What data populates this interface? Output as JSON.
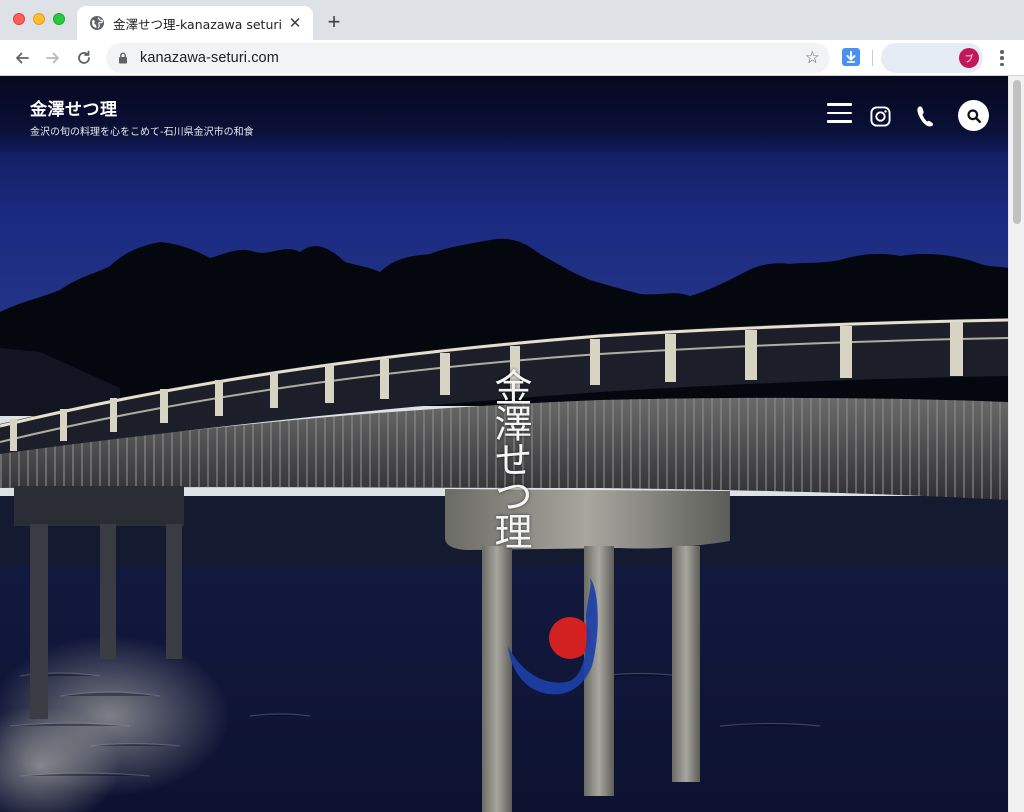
{
  "browser": {
    "tab_title": "金澤せつ理-kanazawa seturi-公式",
    "url": "kanazawa-seturi.com",
    "profile_initial": "ブ"
  },
  "site": {
    "title": "金澤せつ理",
    "description": "金沢の旬の料理を心をこめて-石川県金沢市の和食"
  },
  "hero": {
    "logo_calligraphy": "金澤せつ理"
  },
  "colors": {
    "header_bg": "#05081c",
    "sky": "#1f2f82",
    "accent_red": "#d32020",
    "accent_blue": "#1d3fa8"
  }
}
